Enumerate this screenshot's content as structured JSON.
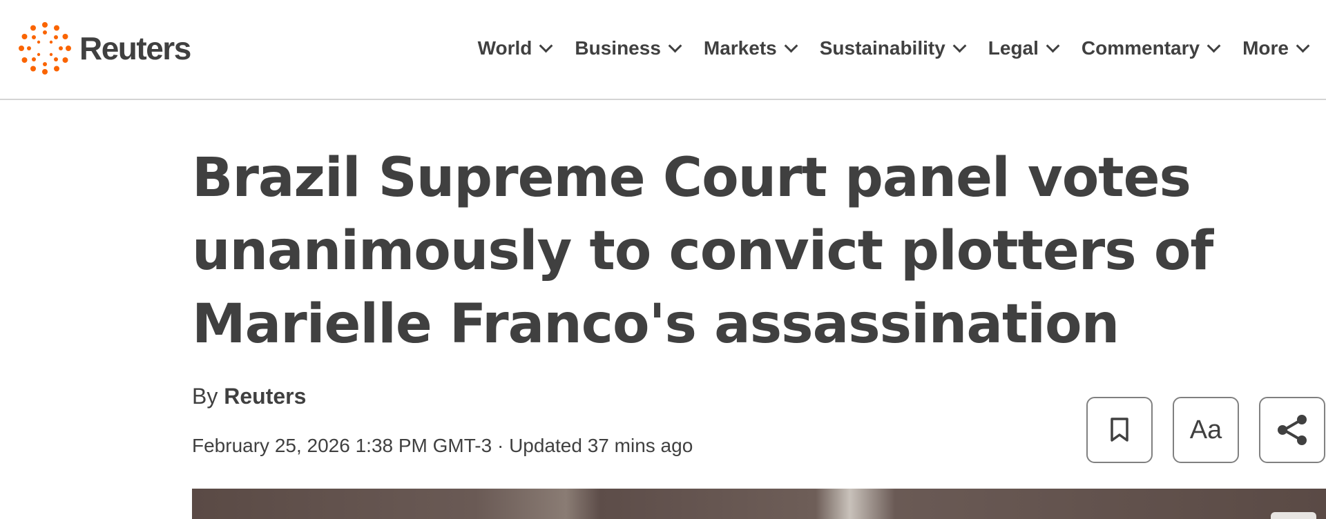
{
  "brand": {
    "name": "Reuters",
    "accent_color": "#fa6400",
    "text_color": "#404040"
  },
  "nav": {
    "items": [
      {
        "label": "World"
      },
      {
        "label": "Business"
      },
      {
        "label": "Markets"
      },
      {
        "label": "Sustainability"
      },
      {
        "label": "Legal"
      },
      {
        "label": "Commentary"
      },
      {
        "label": "More"
      }
    ],
    "dropdown_icon": "chevron-down-icon"
  },
  "article": {
    "headline_lines": [
      "Brazil Supreme Court panel votes",
      "unanimously to convict plotters of",
      "Marielle Franco's assassination"
    ],
    "byline_prefix": "By",
    "byline_author": "Reuters",
    "dateline": "February 25, 2026 1:38 PM GMT-3 · Updated 37 mins ago"
  },
  "toolbar": {
    "bookmark_icon": "bookmark-icon",
    "text_size_label": "Aa",
    "share_icon": "share-icon"
  }
}
